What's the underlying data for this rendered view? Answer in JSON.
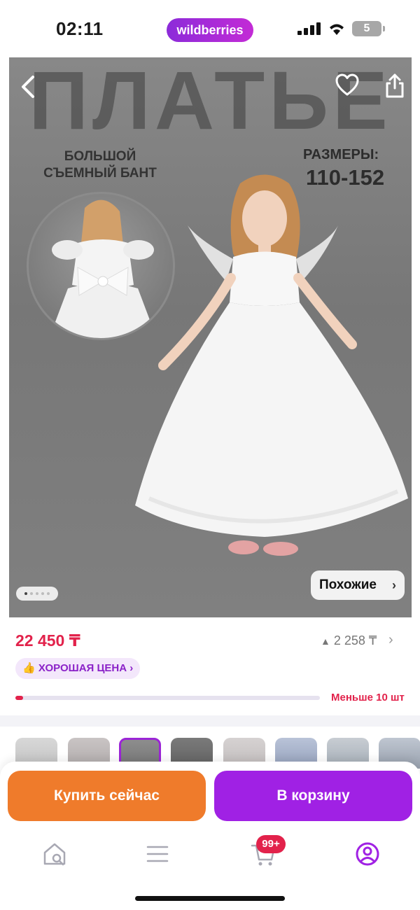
{
  "status_bar": {
    "time": "02:11",
    "brand": "wildberries",
    "battery": "5"
  },
  "hero": {
    "title": "ПЛАТЬЕ",
    "left_text_line1": "БОЛЬШОЙ",
    "left_text_line2": "СЪЕМНЫЙ БАНТ",
    "sizes_label": "РАЗМЕРЫ:",
    "sizes_value": "110-152",
    "similar_label": "Похожие",
    "gallery_index": 1,
    "gallery_count": 5
  },
  "product": {
    "price": "22 450 ₸",
    "old_price": "2 258 ₸",
    "badge_label": "ХОРОШАЯ ЦЕНА",
    "stock_label": "Меньше 10 шт",
    "stock_fraction": 0.025
  },
  "actions": {
    "buy_now": "Купить сейчас",
    "add_to_cart": "В корзину"
  },
  "tabbar": {
    "cart_badge": "99+",
    "active_tab": "profile"
  },
  "icons": {
    "back": "chevron-left-icon",
    "favorite": "heart-icon",
    "share": "share-icon",
    "home": "home-search-icon",
    "catalog": "menu-icon",
    "cart": "cart-icon",
    "profile": "profile-icon"
  },
  "colors": {
    "brand": "#a021e4",
    "price": "#e2224b",
    "buy_now": "#ef7b2b"
  }
}
